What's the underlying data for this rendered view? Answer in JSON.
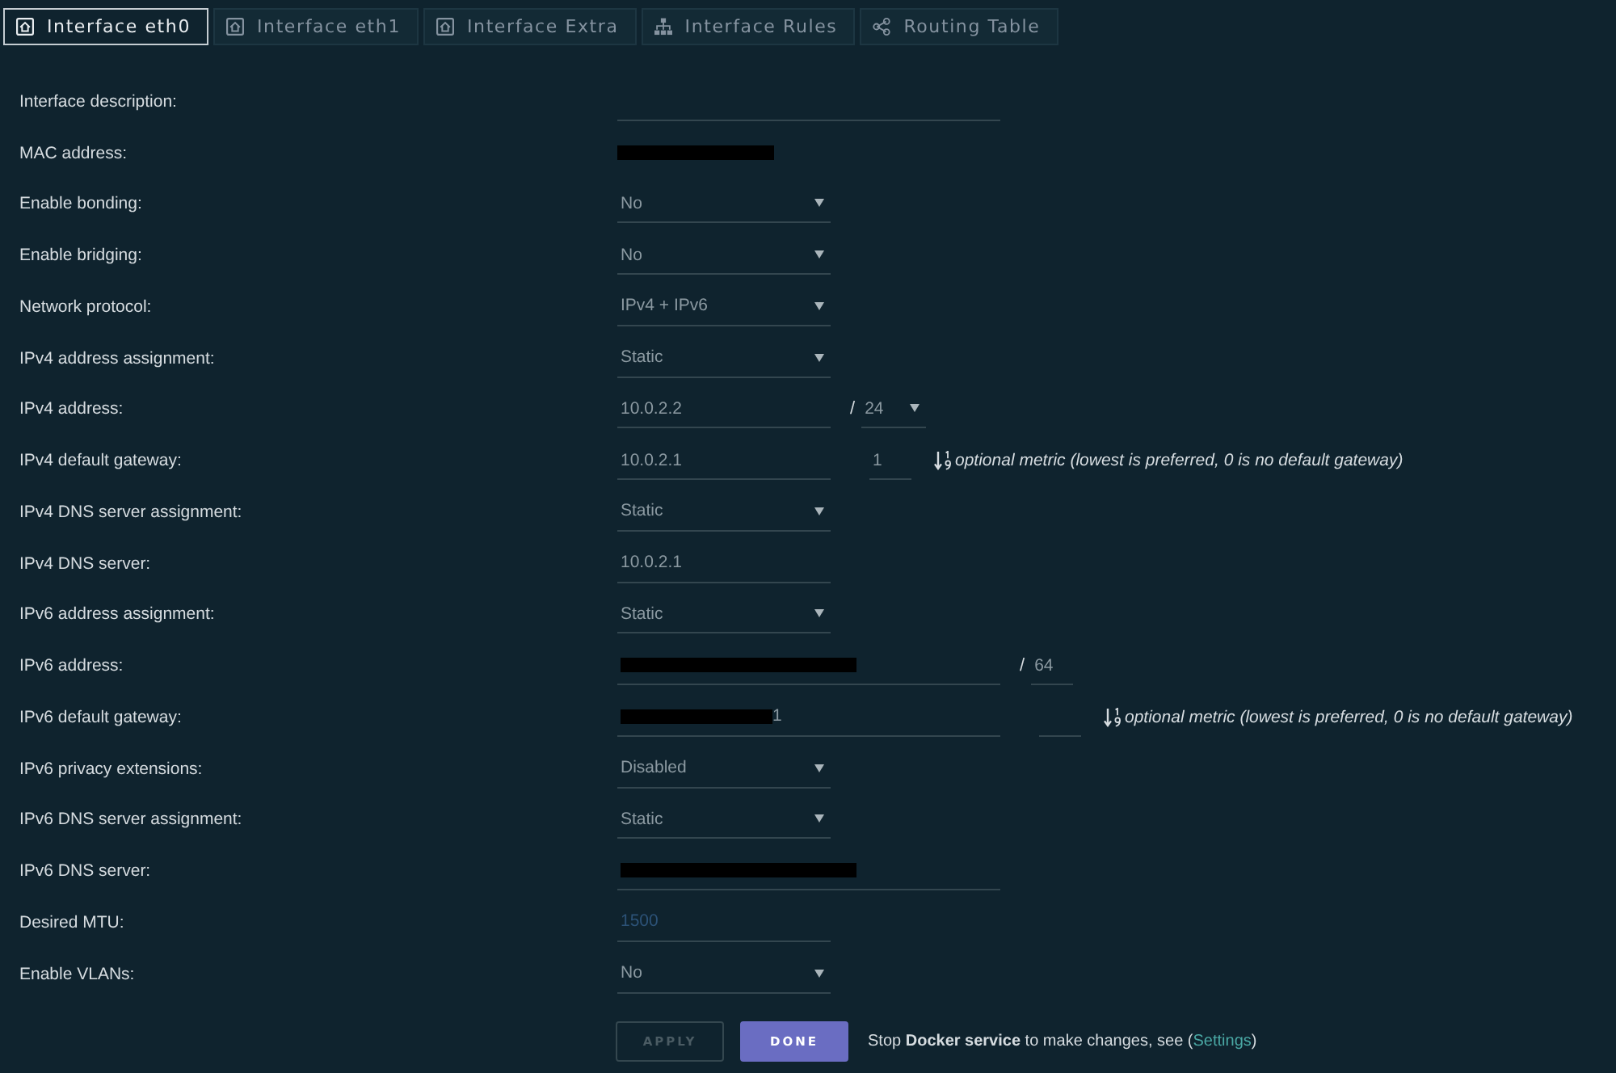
{
  "tabs": [
    {
      "label": "Interface eth0",
      "kind": "interface",
      "selected": true
    },
    {
      "label": "Interface eth1",
      "kind": "interface",
      "selected": false
    },
    {
      "label": "Interface Extra",
      "kind": "interface",
      "selected": false
    },
    {
      "label": "Interface Rules",
      "kind": "rules",
      "selected": false
    },
    {
      "label": "Routing Table",
      "kind": "routing",
      "selected": false
    }
  ],
  "form": {
    "rows": [
      {
        "label": "Interface description:",
        "field": {
          "kind": "text",
          "wide": true
        }
      },
      {
        "label": "MAC address:",
        "field": {
          "kind": "static",
          "redacted": true
        }
      },
      {
        "label": "Enable bonding:",
        "field": {
          "kind": "select",
          "value": "No"
        }
      },
      {
        "label": "Enable bridging:",
        "field": {
          "kind": "select",
          "value": "No"
        }
      },
      {
        "label": "Network protocol:",
        "field": {
          "kind": "select",
          "value": "IPv4 + IPv6"
        }
      },
      {
        "label": "IPv4 address assignment:",
        "field": {
          "kind": "select",
          "value": "Static"
        }
      },
      {
        "label": "IPv4 address:",
        "field": {
          "kind": "text",
          "value": "10.0.2.2"
        },
        "prefix": {
          "separator": "/",
          "field": {
            "kind": "select",
            "value": "24"
          }
        }
      },
      {
        "label": "IPv4 default gateway:",
        "field": {
          "kind": "text",
          "value": "10.0.2.1"
        },
        "metric": {
          "field": {
            "kind": "text",
            "value": "1"
          },
          "hint": "optional metric (lowest is preferred, 0 is no default gateway)"
        }
      },
      {
        "label": "IPv4 DNS server assignment:",
        "field": {
          "kind": "select",
          "value": "Static"
        }
      },
      {
        "label": "IPv4 DNS server:",
        "field": {
          "kind": "text",
          "value": "10.0.2.1"
        }
      },
      {
        "label": "IPv6 address assignment:",
        "field": {
          "kind": "select",
          "value": "Static"
        }
      },
      {
        "label": "IPv6 address:",
        "field": {
          "kind": "text",
          "wide": true,
          "redacted": true
        },
        "prefix": {
          "separator": "/",
          "field": {
            "kind": "text",
            "value": "64"
          }
        }
      },
      {
        "label": "IPv6 default gateway:",
        "field": {
          "kind": "text",
          "wide": true,
          "redacted": true,
          "value": "1"
        },
        "metric": {
          "field": {
            "kind": "text"
          },
          "hint": "optional metric (lowest is preferred, 0 is no default gateway)"
        }
      },
      {
        "label": "IPv6 privacy extensions:",
        "field": {
          "kind": "select",
          "value": "Disabled"
        }
      },
      {
        "label": "IPv6 DNS server assignment:",
        "field": {
          "kind": "select",
          "value": "Static"
        }
      },
      {
        "label": "IPv6 DNS server:",
        "field": {
          "kind": "text",
          "wide": true,
          "redacted": true
        }
      },
      {
        "label": "Desired MTU:",
        "field": {
          "kind": "text",
          "placeholder": "1500"
        }
      },
      {
        "label": "Enable VLANs:",
        "field": {
          "kind": "select",
          "value": "No"
        }
      }
    ]
  },
  "actions": {
    "buttons": [
      {
        "label": "APPLY",
        "disabled": true
      },
      {
        "label": "DONE",
        "disabled": false
      }
    ],
    "notice": {
      "text": "Stop **Docker service** to make changes, see (",
      "link": "Settings",
      "text_after": ")"
    }
  }
}
